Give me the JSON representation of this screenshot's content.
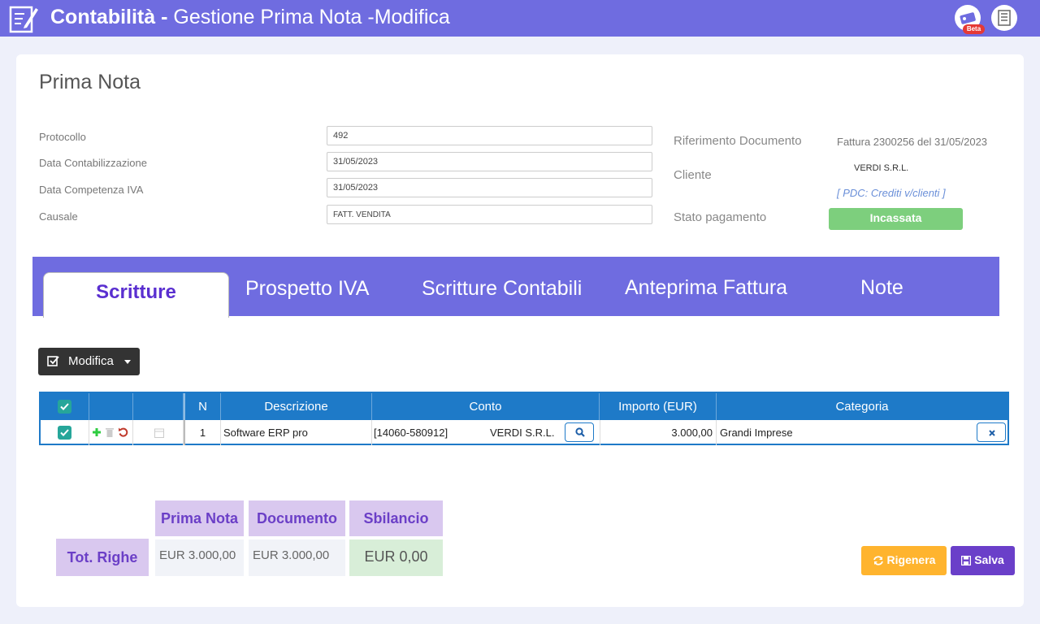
{
  "header": {
    "app_title": "Contabilità",
    "separator": " - ",
    "subtitle": "Gestione Prima Nota -Modifica",
    "beta_badge": "Beta"
  },
  "page": {
    "title": "Prima Nota"
  },
  "form": {
    "protocollo": {
      "label": "Protocollo",
      "value": "492"
    },
    "data_contabilizzazione": {
      "label": "Data Contabilizzazione",
      "value": "31/05/2023"
    },
    "data_competenza_iva": {
      "label": "Data Competenza IVA",
      "value": "31/05/2023"
    },
    "causale": {
      "label": "Causale",
      "value": "FATT. VENDITA"
    }
  },
  "info": {
    "riferimento_label": "Riferimento Documento",
    "riferimento_value": "Fattura 2300256 del 31/05/2023",
    "cliente_label": "Cliente",
    "cliente_name": "VERDI S.R.L.",
    "cliente_pdc": "[ PDC: Crediti v/clienti ]",
    "stato_label": "Stato pagamento",
    "stato_value": "Incassata",
    "stato_color": "#7dcf7d"
  },
  "tabs": [
    "Scritture",
    "Prospetto IVA",
    "Scritture Contabili",
    "Anteprima Fattura",
    "Note"
  ],
  "toolbar": {
    "modifica_label": "Modifica"
  },
  "table": {
    "headers": {
      "n": "N",
      "descrizione": "Descrizione",
      "conto": "Conto",
      "importo": "Importo (EUR)",
      "categoria": "Categoria"
    },
    "rows": [
      {
        "n": "1",
        "descrizione": "Software ERP pro",
        "conto_codice": "[14060-580912]",
        "conto_nome": "VERDI S.R.L.",
        "importo": "3.000,00",
        "categoria": "Grandi Imprese"
      }
    ]
  },
  "totals": {
    "row_label": "Tot. Righe",
    "prima_nota_label": "Prima Nota",
    "documento_label": "Documento",
    "sbilancio_label": "Sbilancio",
    "prima_nota_value": "EUR 3.000,00",
    "documento_value": "EUR 3.000,00",
    "sbilancio_value": "EUR 0,00"
  },
  "actions": {
    "rigenera_label": "Rigenera",
    "salva_label": "Salva"
  },
  "colors": {
    "header": "#6f6ce0",
    "accent": "#5a2fd0",
    "table": "#1e7ac8",
    "rigenera": "#ffb42e",
    "salva": "#6a3fc9"
  }
}
